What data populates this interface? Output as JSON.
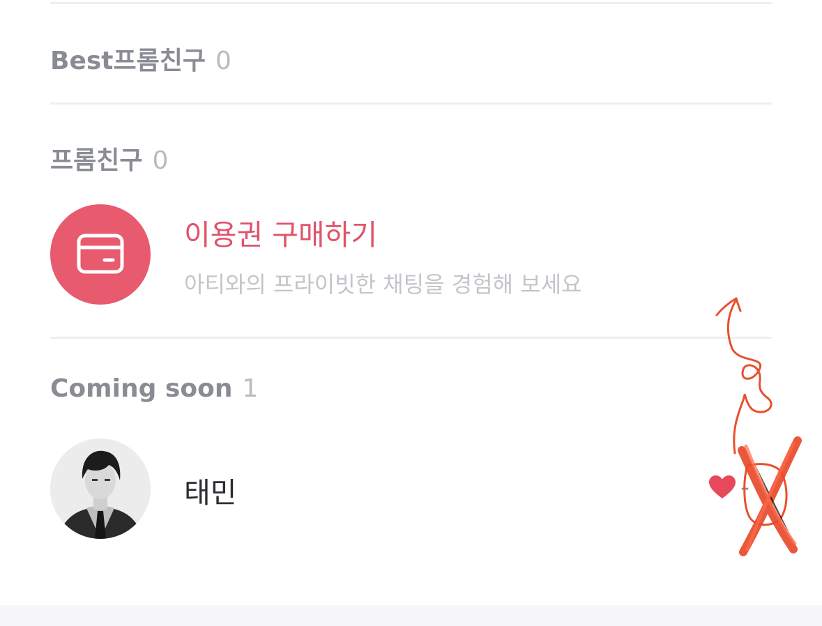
{
  "sections": {
    "best": {
      "label": "Best프롬친구",
      "count": "0"
    },
    "friends": {
      "label": "프롬친구",
      "count": "0"
    },
    "coming_soon": {
      "label": "Coming soon",
      "count": "1"
    }
  },
  "purchase": {
    "title": "이용권 구매하기",
    "subtitle": "아티와의 프라이빗한 채팅을 경험해 보세요",
    "icon": "credit-card-icon"
  },
  "artist": {
    "name": "태민",
    "like_count": "-",
    "icons": {
      "heart": "heart-icon",
      "avatar": "profile-photo"
    }
  },
  "colors": {
    "accent": "#e85a6e",
    "title_accent": "#e0536a",
    "header_text": "#8a8c94",
    "annotation": "#e8502e"
  }
}
